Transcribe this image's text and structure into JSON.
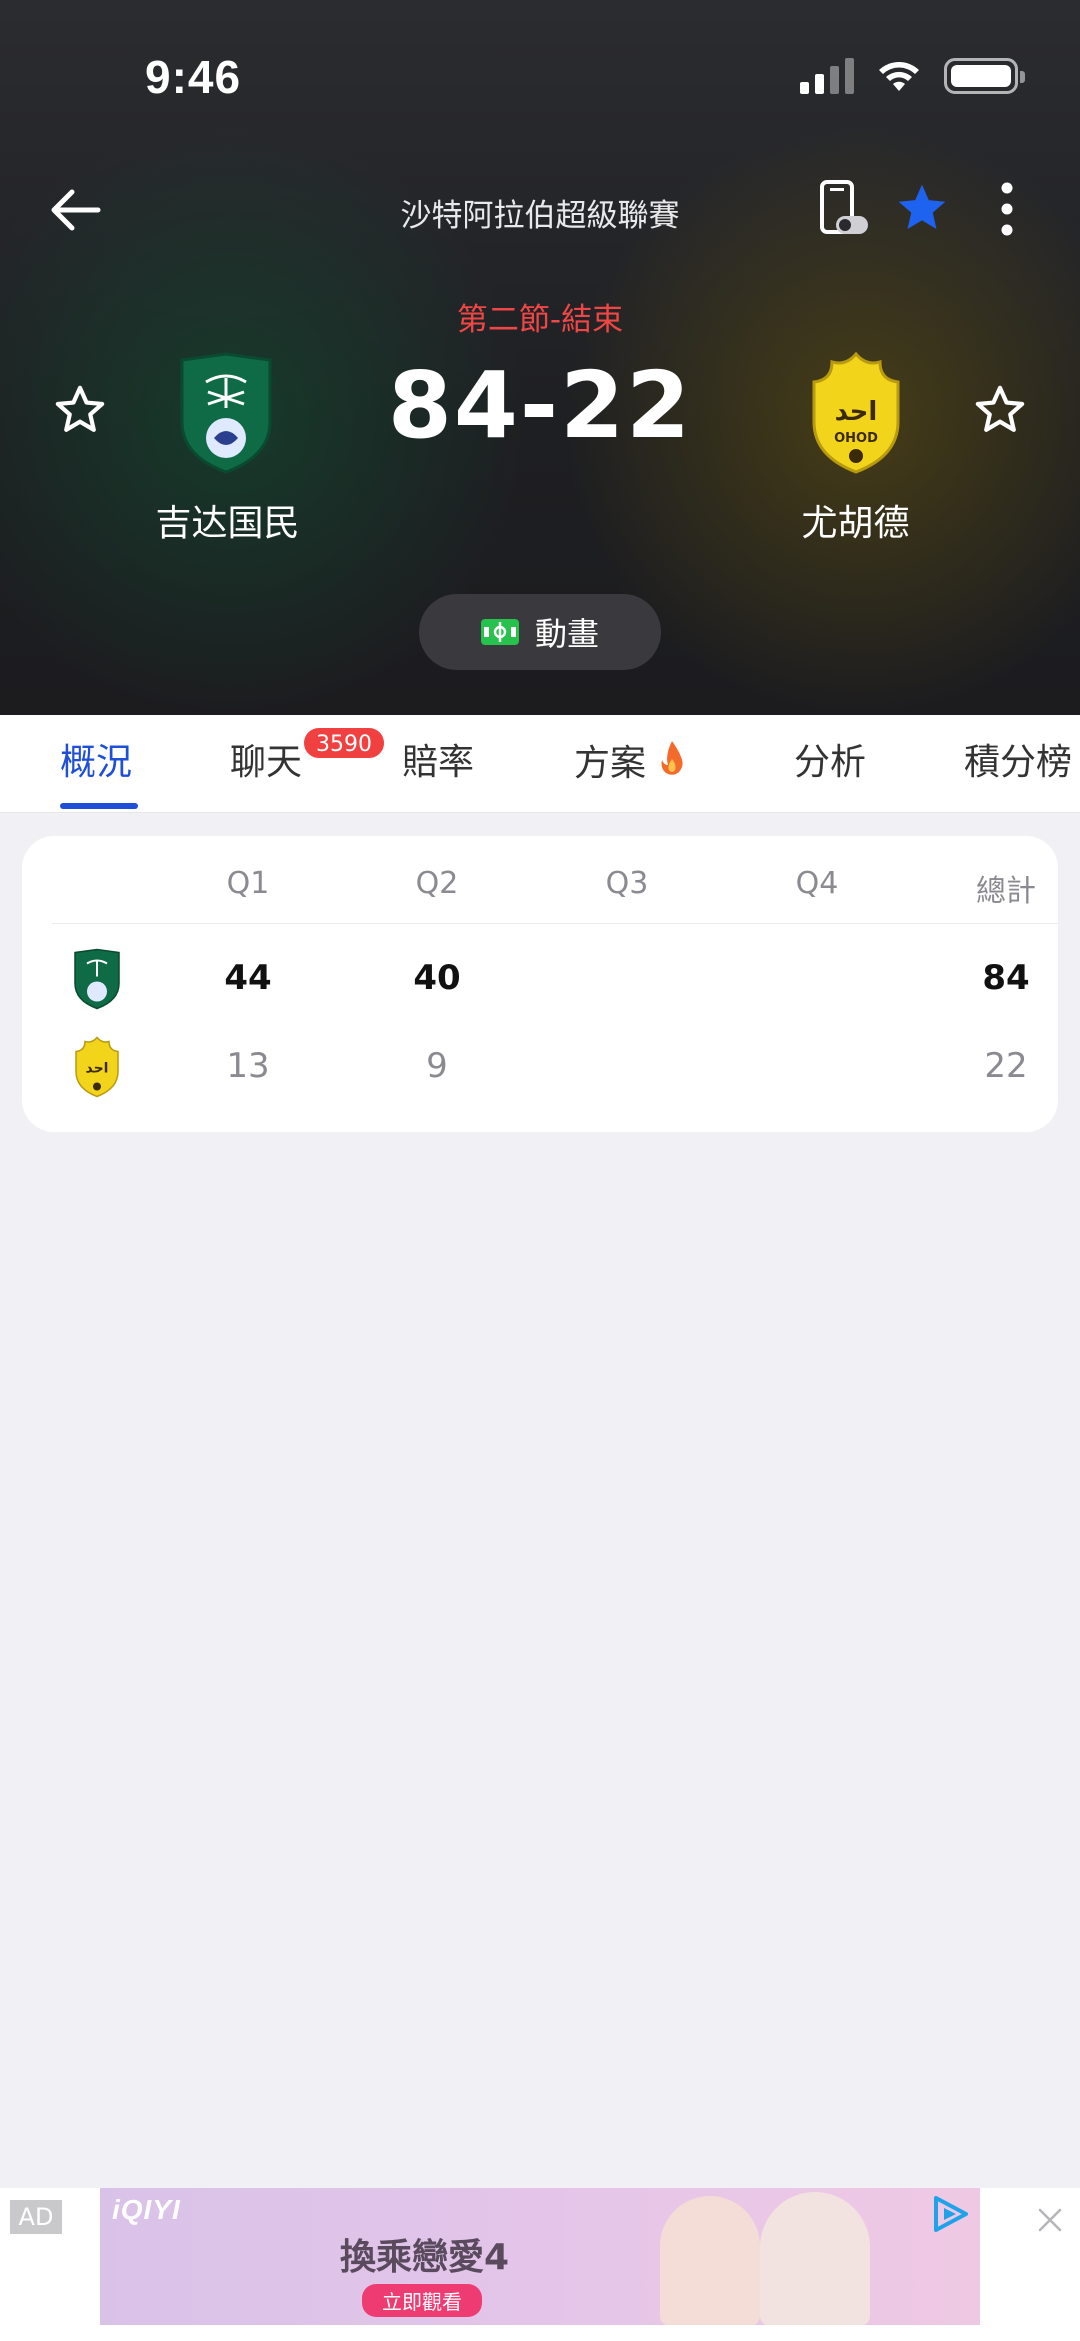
{
  "status_bar": {
    "time": "9:46"
  },
  "header": {
    "league": "沙特阿拉伯超級聯賽",
    "period": "第二節-結束",
    "score": "84-22",
    "home_team": "吉达国民",
    "away_team": "尤胡德",
    "animation_label": "動畫",
    "accent_color": "#1f4fd8",
    "period_color": "#f04646"
  },
  "tabs": [
    {
      "label": "概況"
    },
    {
      "label": "聊天"
    },
    {
      "label": "賠率"
    },
    {
      "label": "方案"
    },
    {
      "label": "分析"
    },
    {
      "label": "積分榜"
    }
  ],
  "chat_badge": "3590",
  "scoreboard": {
    "headers": [
      "Q1",
      "Q2",
      "Q3",
      "Q4",
      "總計"
    ],
    "home": {
      "q1": "44",
      "q2": "40",
      "q3": "",
      "q4": "",
      "total": "84"
    },
    "away": {
      "q1": "13",
      "q2": "9",
      "q3": "",
      "q4": "",
      "total": "22"
    }
  },
  "ad": {
    "tag": "AD",
    "brand": "iQIYI",
    "headline": "換乘戀愛4",
    "cta": "立即觀看"
  }
}
